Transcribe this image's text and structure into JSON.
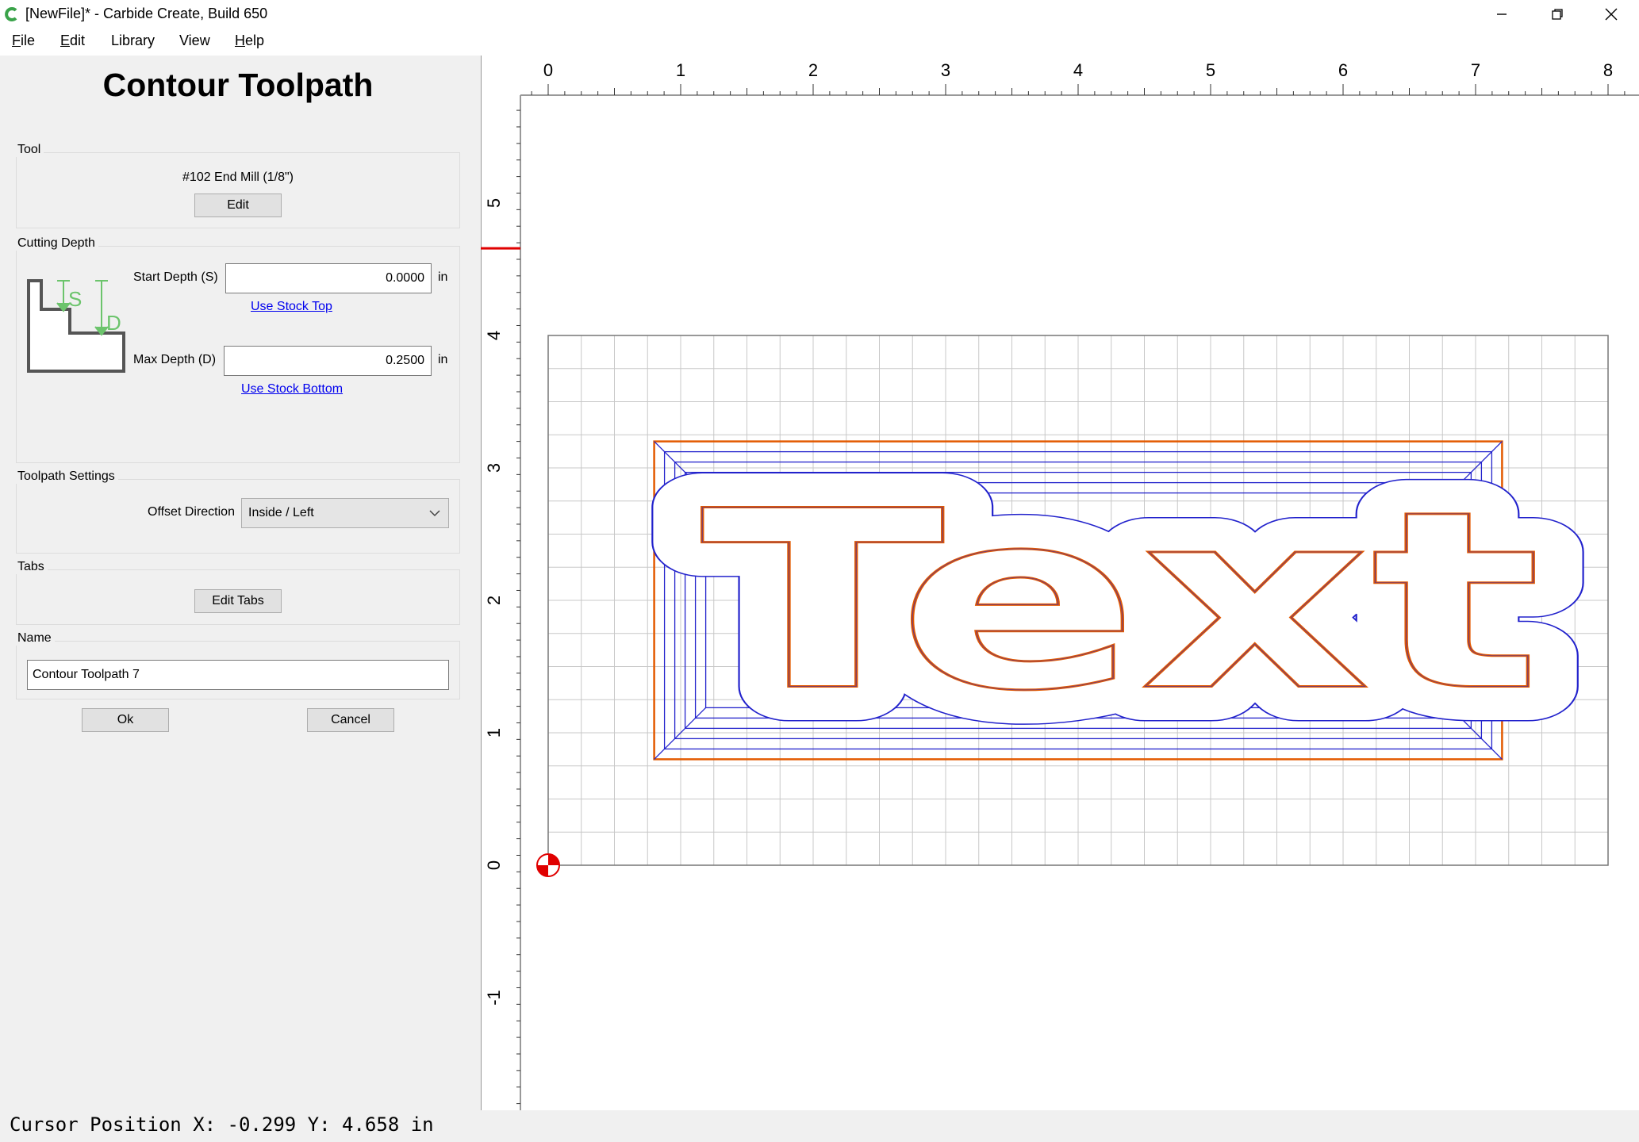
{
  "window": {
    "title": "[NewFile]* - Carbide Create, Build 650"
  },
  "menu": [
    {
      "underline": "F",
      "rest": "ile"
    },
    {
      "underline": "E",
      "rest": "dit"
    },
    {
      "underline": "",
      "rest": "Library"
    },
    {
      "underline": "",
      "rest": "View"
    },
    {
      "underline": "H",
      "rest": "elp"
    }
  ],
  "panel": {
    "title": "Contour Toolpath",
    "tool": {
      "label": "Tool",
      "name": "#102 End Mill (1/8\")",
      "edit_label": "Edit"
    },
    "cutting_depth": {
      "label": "Cutting Depth",
      "start_label": "Start Depth (S)",
      "start_value": "0.0000",
      "start_unit": "in",
      "use_top": "Use Stock Top",
      "max_label": "Max Depth (D)",
      "max_value": "0.2500",
      "max_unit": "in",
      "use_bottom": "Use Stock Bottom",
      "diagram_s": "S",
      "diagram_d": "D"
    },
    "toolpath_settings": {
      "label": "Toolpath Settings",
      "offset_label": "Offset Direction",
      "offset_value": "Inside / Left"
    },
    "tabs": {
      "label": "Tabs",
      "edit_tabs": "Edit Tabs"
    },
    "name": {
      "label": "Name",
      "value": "Contour Toolpath 7"
    },
    "ok_label": "Ok",
    "cancel_label": "Cancel"
  },
  "status": {
    "cursor_position": "Cursor Position X: -0.299 Y: 4.658 in"
  },
  "canvas": {
    "x_ticks": [
      "0",
      "1",
      "2",
      "3",
      "4",
      "5",
      "6",
      "7",
      "8"
    ],
    "y_ticks": [
      "5",
      "4",
      "3",
      "2",
      "1",
      "0",
      "-1"
    ],
    "cursor_marker_y": 4.658,
    "stock_x": [
      0,
      8
    ],
    "stock_y": [
      0,
      4
    ],
    "text_word": "Text",
    "colors": {
      "toolpath": "#2222cc",
      "selection": "#e35a00",
      "grid": "#c8c8c8",
      "origin": "#e00000",
      "accent_green": "#6cc46c"
    }
  }
}
